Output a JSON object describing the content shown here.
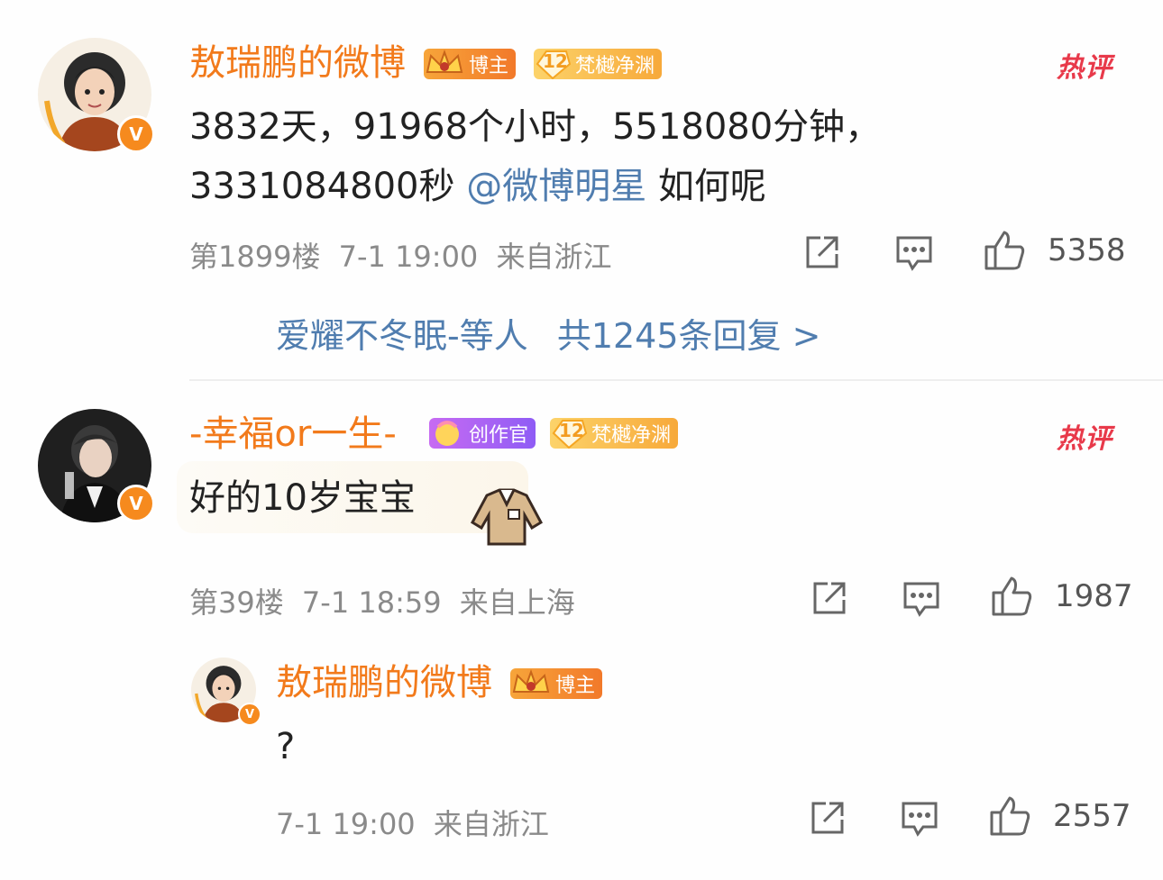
{
  "comments": [
    {
      "author": "敖瑞鹏的微博",
      "badge_role": "博主",
      "badge_level": "12",
      "badge_fan": "梵樾净渊",
      "hot": "热评",
      "text_line1": "3832天，91968个小时，5518080分钟，",
      "text_line2_prefix": "3331084800秒 ",
      "mention": "@微博明星",
      "text_line2_suffix": " 如何呢",
      "floor": "第1899楼",
      "time": "7-1 19:00",
      "location": "来自浙江",
      "likes": "5358",
      "replies_preview": "爱耀不冬眠-等人",
      "replies_count": "共1245条回复 >"
    },
    {
      "author": "-幸福or一生-",
      "badge_role": "创作官",
      "badge_level": "12",
      "badge_fan": "梵樾净渊",
      "hot": "热评",
      "text": "好的10岁宝宝",
      "floor": "第39楼",
      "time": "7-1 18:59",
      "location": "来自上海",
      "likes": "1987"
    }
  ],
  "reply": {
    "author": "敖瑞鹏的微博",
    "badge_role": "博主",
    "text": "?",
    "time": "7-1 19:00",
    "location": "来自浙江",
    "likes": "2557"
  },
  "verified_mark": "V",
  "colors": {
    "name": "#f27a1b",
    "link": "#507daf",
    "hot": "#e8394a",
    "meta": "#8a8a8a",
    "vip": "#f68a1e"
  },
  "icons": [
    "share-icon",
    "comment-icon",
    "like-icon",
    "crown-badge-icon",
    "diamond-level-icon"
  ]
}
